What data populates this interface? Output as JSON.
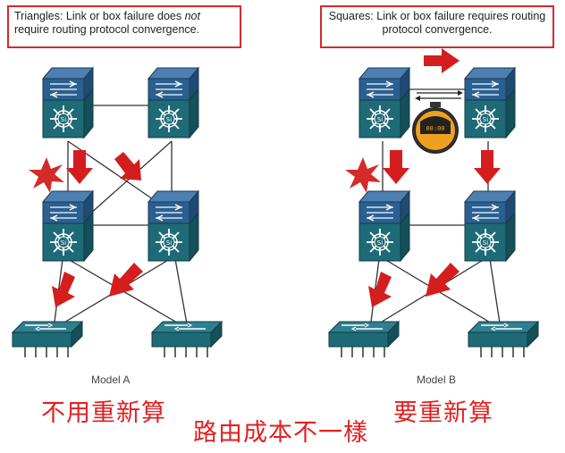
{
  "caption_a": {
    "prefix": "Triangles: Link or box failure does ",
    "emph": "not",
    "suffix": " require routing protocol convergence."
  },
  "caption_b": {
    "text": "Squares: Link or box failure requires routing protocol convergence."
  },
  "model_a_label": "Model A",
  "model_b_label": "Model B",
  "zh_left": "不用重新算",
  "zh_middle": "路由成本不一樣",
  "zh_right": "要重新算",
  "stopwatch_display": "00:00",
  "colors": {
    "router_top": "#2b5f8f",
    "router_body": "#1e6a77",
    "arrow": "#d41e1e",
    "star": "#d42a2a",
    "stopwatch": "#f0a020"
  }
}
